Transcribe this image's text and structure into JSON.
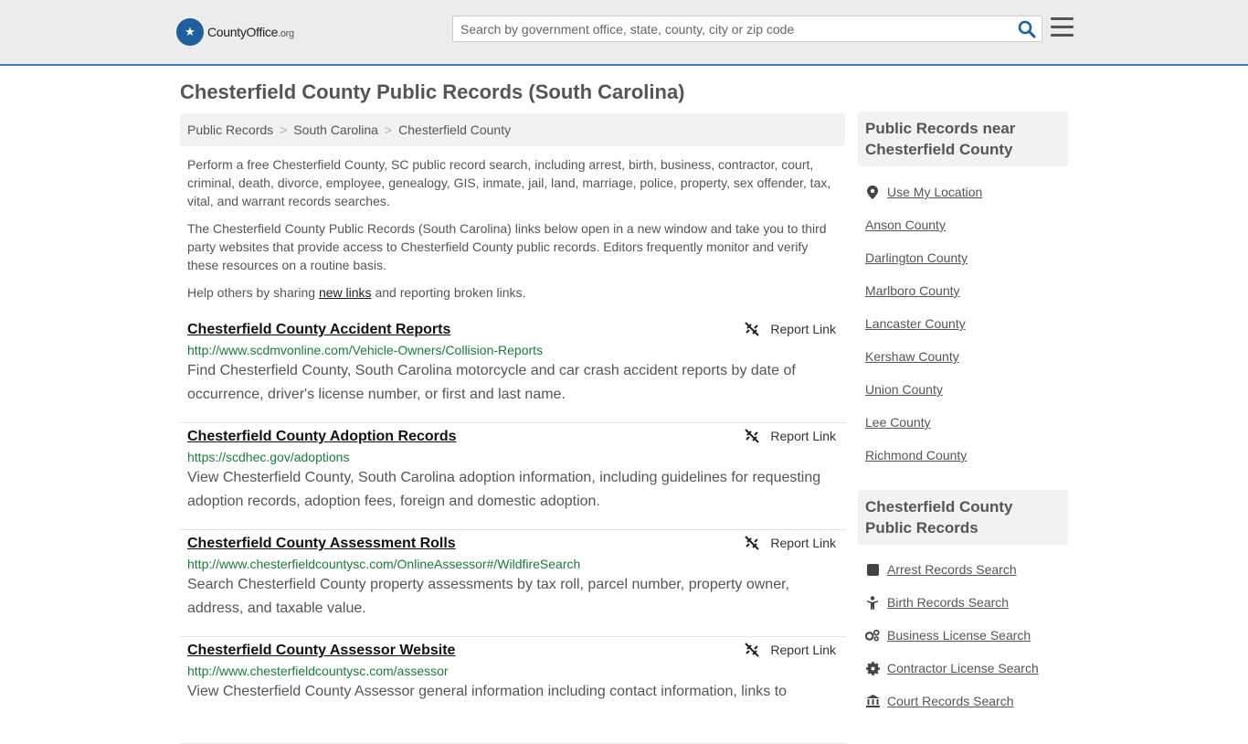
{
  "header": {
    "logo_brand": "CountyOffice",
    "logo_tld": ".org",
    "search_placeholder": "Search by government office, state, county, city or zip code"
  },
  "page_title": "Chesterfield County Public Records (South Carolina)",
  "breadcrumb": [
    "Public Records",
    "South Carolina",
    "Chesterfield County"
  ],
  "intro": {
    "p1": "Perform a free Chesterfield County, SC public record search, including arrest, birth, business, contractor, court, criminal, death, divorce, employee, genealogy, GIS, inmate, jail, land, marriage, police, property, sex offender, tax, vital, and warrant records searches.",
    "p2": "The Chesterfield County Public Records (South Carolina) links below open in a new window and take you to third party websites that provide access to Chesterfield County public records. Editors frequently monitor and verify these resources on a routine basis.",
    "p3_before": "Help others by sharing ",
    "p3_link": "new links",
    "p3_after": " and reporting broken links."
  },
  "report_label": "Report Link",
  "records": [
    {
      "title": "Chesterfield County Accident Reports",
      "url": "http://www.scdmvonline.com/Vehicle-Owners/Collision-Reports",
      "desc": "Find Chesterfield County, South Carolina motorcycle and car crash accident reports by date of occurrence, driver's license number, or first and last name."
    },
    {
      "title": "Chesterfield County Adoption Records",
      "url": "https://scdhec.gov/adoptions",
      "desc": "View Chesterfield County, South Carolina adoption information, including guidelines for requesting adoption records, adoption fees, foreign and domestic adoption."
    },
    {
      "title": "Chesterfield County Assessment Rolls",
      "url": "http://www.chesterfieldcountysc.com/OnlineAssessor#/WildfireSearch",
      "desc": "Search Chesterfield County property assessments by tax roll, parcel number, property owner, address, and taxable value."
    },
    {
      "title": "Chesterfield County Assessor Website",
      "url": "http://www.chesterfieldcountysc.com/assessor",
      "desc": "View Chesterfield County Assessor general information including contact information, links to"
    }
  ],
  "sidebar": {
    "near_heading": "Public Records near Chesterfield County",
    "use_location": "Use My Location",
    "near": [
      "Anson County",
      "Darlington County",
      "Marlboro County",
      "Lancaster County",
      "Kershaw County",
      "Union County",
      "Lee County",
      "Richmond County"
    ],
    "county_heading": "Chesterfield County Public Records",
    "searches": [
      {
        "label": "Arrest Records Search",
        "icon": "arrest-icon"
      },
      {
        "label": "Birth Records Search",
        "icon": "birth-icon"
      },
      {
        "label": "Business License Search",
        "icon": "business-icon"
      },
      {
        "label": "Contractor License Search",
        "icon": "contractor-icon"
      },
      {
        "label": "Court Records Search",
        "icon": "court-icon"
      }
    ]
  }
}
